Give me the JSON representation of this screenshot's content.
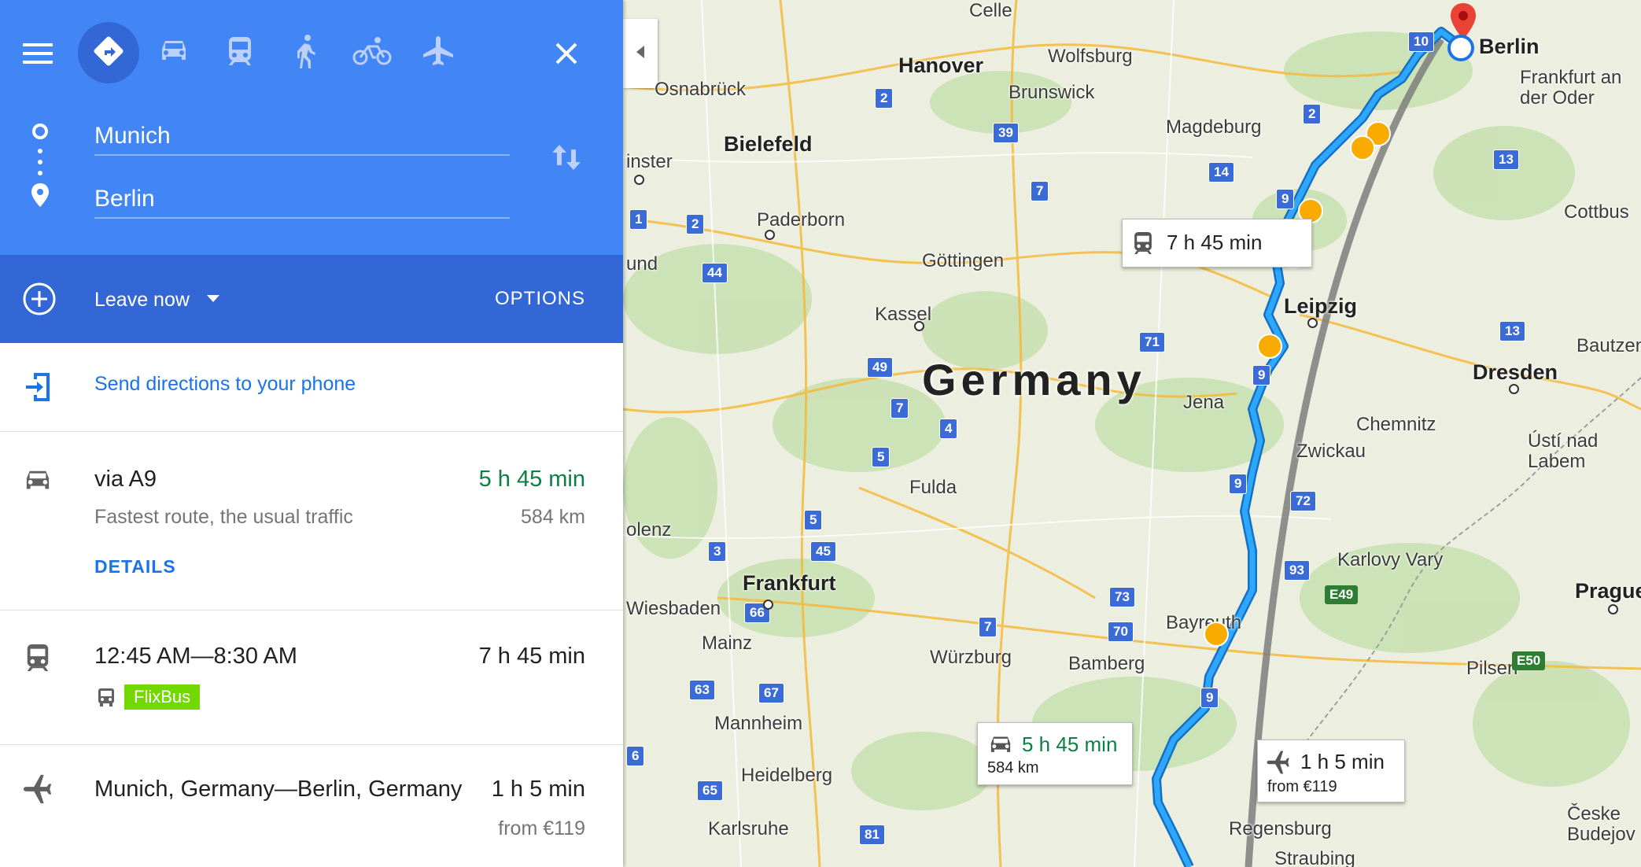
{
  "header": {
    "menu_icon": "hamburger-icon",
    "modes": [
      {
        "name": "best-route",
        "icon": "directions-diamond-icon",
        "active": true
      },
      {
        "name": "driving",
        "icon": "car-icon",
        "active": false
      },
      {
        "name": "transit",
        "icon": "train-icon",
        "active": false
      },
      {
        "name": "walking",
        "icon": "walk-icon",
        "active": false
      },
      {
        "name": "cycling",
        "icon": "bike-icon",
        "active": false
      },
      {
        "name": "flights",
        "icon": "plane-icon",
        "active": false
      }
    ],
    "close_icon": "close-icon"
  },
  "inputs": {
    "origin": "Munich",
    "destination": "Berlin"
  },
  "leave": {
    "label": "Leave now",
    "options_label": "OPTIONS"
  },
  "send": {
    "label": "Send directions to your phone"
  },
  "routes": {
    "drive": {
      "title": "via A9",
      "duration": "5 h 45 min",
      "subtitle": "Fastest route, the usual traffic",
      "distance": "584 km",
      "details_label": "DETAILS"
    },
    "transit": {
      "time_range": "12:45 AM—8:30 AM",
      "duration": "7 h 45 min",
      "operator": "FlixBus"
    },
    "flight": {
      "title": "Munich, Germany—Berlin, Germany",
      "duration": "1 h 5 min",
      "price": "from €119"
    }
  },
  "map": {
    "country": "Germany",
    "cities": [
      "Celle",
      "Hanover",
      "Wolfsburg",
      "Osnabrück",
      "Brunswick",
      "Magdeburg",
      "Bielefeld",
      "Paderborn",
      "Göttingen",
      "Kassel",
      "Leipzig",
      "Jena",
      "Fulda",
      "Chemnitz",
      "Zwickau",
      "Dresden",
      "Frankfurt",
      "Wiesbaden",
      "Mainz",
      "Würzburg",
      "Bamberg",
      "Bayreuth",
      "Mannheim",
      "Heidelberg",
      "Karlsruhe",
      "Regensburg",
      "Straubing",
      "Karlovy Vary",
      "Prague",
      "Pilsen",
      "Cottbus",
      "Bautzen",
      "Ústí nad Labem",
      "Berlin",
      "Frankfurt an der Oder",
      "Česke Budejov",
      "inster",
      "und",
      "olenz"
    ],
    "callouts": {
      "transit": "7 h 45 min",
      "drive_time": "5 h 45 min",
      "drive_dist": "584 km",
      "flight_time": "1 h 5 min",
      "flight_price": "from €119"
    },
    "colors": {
      "route": "#1a9bf0",
      "header": "#4285f4",
      "header_dark": "#3367d6",
      "green_time": "#0b8043",
      "flixbus": "#73d700"
    }
  }
}
